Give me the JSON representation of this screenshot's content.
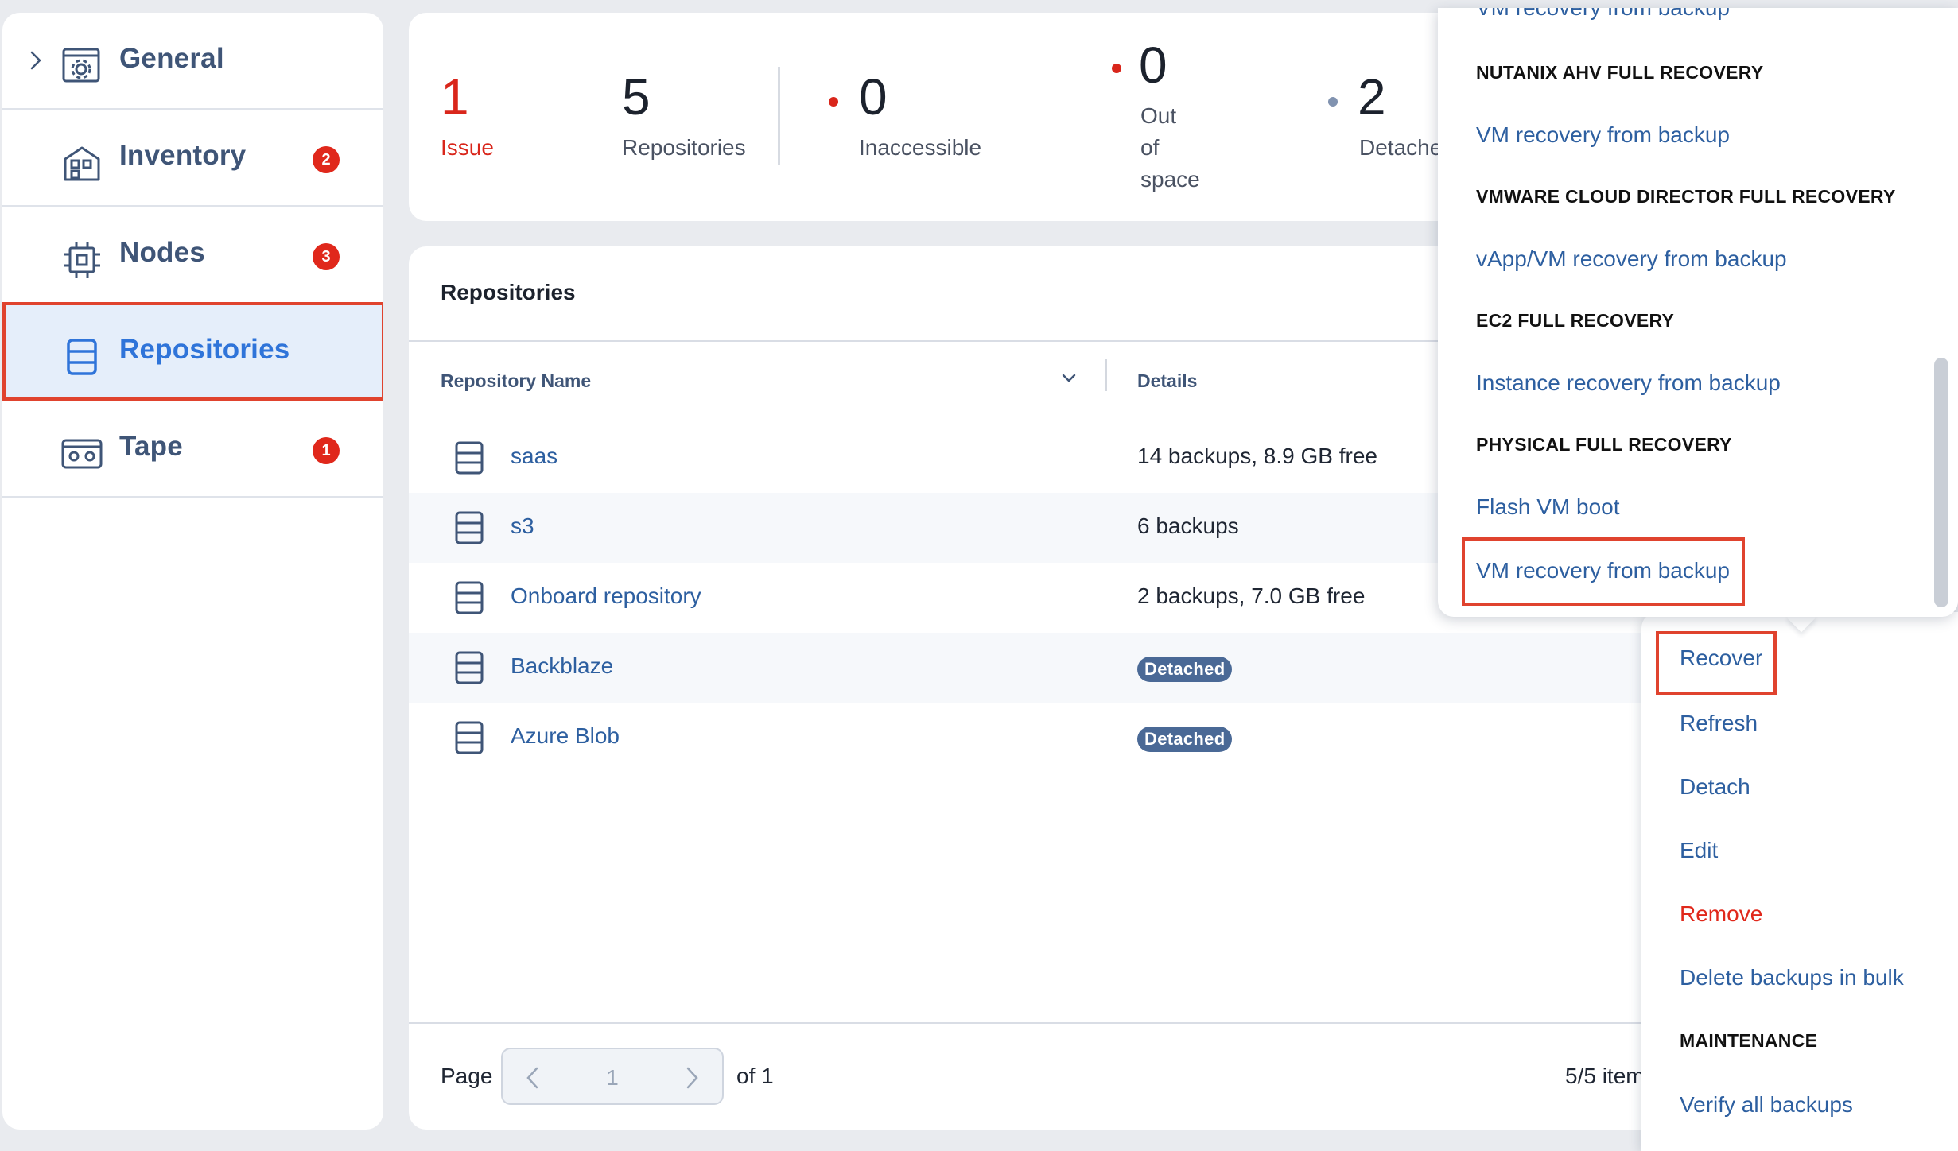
{
  "sidebar": {
    "items": [
      {
        "label": "General",
        "icon": "gear-window-icon",
        "badge": null
      },
      {
        "label": "Inventory",
        "icon": "building-icon",
        "badge": "2"
      },
      {
        "label": "Nodes",
        "icon": "chip-icon",
        "badge": "3"
      },
      {
        "label": "Repositories",
        "icon": "storage-icon",
        "badge": null
      },
      {
        "label": "Tape",
        "icon": "tape-icon",
        "badge": "1"
      }
    ]
  },
  "stats": {
    "issue": {
      "value": "1",
      "label": "Issue"
    },
    "repositories": {
      "value": "5",
      "label": "Repositories"
    },
    "inaccessible": {
      "value": "0",
      "label": "Inaccessible"
    },
    "out_of_space": {
      "value": "0",
      "label_lines": [
        "Out",
        "of",
        "space"
      ]
    },
    "detached": {
      "value": "2",
      "label": "Detache"
    }
  },
  "repos": {
    "title": "Repositories",
    "columns": {
      "name": "Repository Name",
      "details": "Details"
    },
    "rows": [
      {
        "name": "saas",
        "details": "14 backups, 8.9 GB free",
        "badge": null
      },
      {
        "name": "s3",
        "details": "6 backups",
        "badge": null
      },
      {
        "name": "Onboard repository",
        "details": "2 backups, 7.0 GB free",
        "badge": null
      },
      {
        "name": "Backblaze",
        "details": null,
        "badge": "Detached"
      },
      {
        "name": "Azure Blob",
        "details": null,
        "badge": "Detached"
      }
    ],
    "footer": {
      "page_label": "Page",
      "page_value": "1",
      "of_label": "of 1",
      "items_label": "5/5 item"
    }
  },
  "actions_menu": {
    "items": {
      "recover": "Recover",
      "refresh": "Refresh",
      "detach": "Detach",
      "edit": "Edit",
      "remove": "Remove",
      "delete_bulk": "Delete backups in bulk",
      "maintenance_heading": "MAINTENANCE",
      "verify_all": "Verify all backups"
    }
  },
  "recover_submenu": {
    "cut_item": "VM recovery from backup",
    "nutanix_heading": "NUTANIX AHV FULL RECOVERY",
    "nutanix_vm": "VM recovery from backup",
    "vcd_heading": "VMWARE CLOUD DIRECTOR FULL RECOVERY",
    "vcd_vapp": "vApp/VM recovery from backup",
    "ec2_heading": "EC2 FULL RECOVERY",
    "ec2_instance": "Instance recovery from backup",
    "physical_heading": "PHYSICAL FULL RECOVERY",
    "physical_flash": "Flash VM boot",
    "physical_vm": "VM recovery from backup"
  },
  "colors": {
    "accent": "#2f74d9",
    "link": "#2d5fa0",
    "danger": "#e0281b",
    "highlight_border": "#e0432e",
    "nav_text": "#3f5577",
    "detached_pill": "#4a6996"
  }
}
